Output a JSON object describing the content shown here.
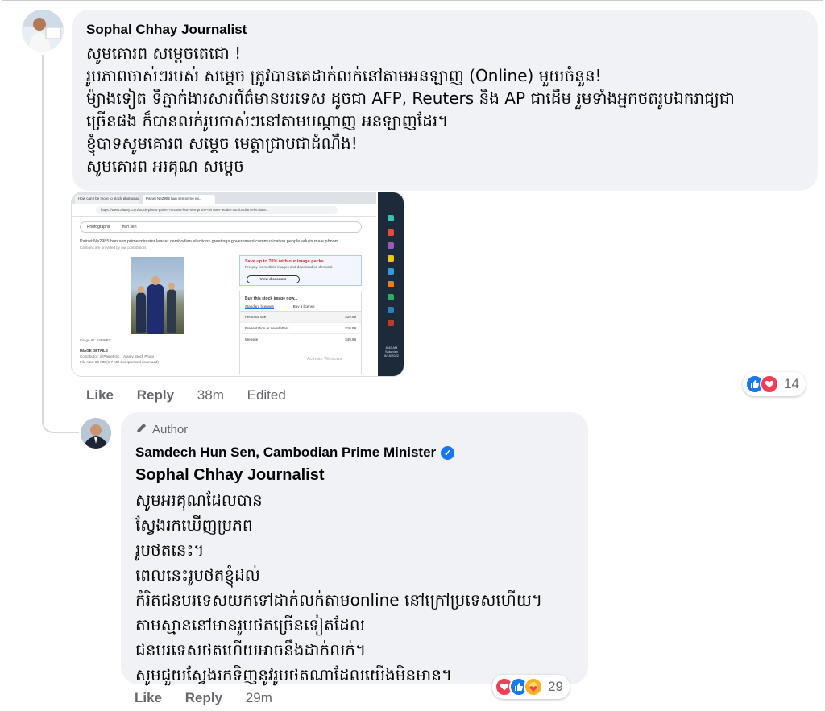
{
  "comment1": {
    "author": "Sophal Chhay Journalist",
    "lines": [
      "សូមគោរព សម្ដេចតេជោ !",
      "រូបភាពចាស់ៗរបស់ សម្ដេច ត្រូវបានគេដាក់លក់នៅតាមអនឡាញ (Online) មួយចំនួន!",
      "ម៉្យាងទៀត ទីភ្នាក់ងារសារព័ត៌មានបរទេស ដូចជា AFP, Reuters និង AP ជាដើម រួមទាំងអ្នកថតរូបឯករាជ្យជា",
      "ច្រើនផង ក៏បានលក់រូបចាស់ៗនៅតាមបណ្ដាញ អនឡាញដែរ។",
      "ខ្ញុំបាទសូមគោរព សម្ដេច មេត្តាជ្រាបជាដំណឹង!",
      "សូមគោរព អរគុណ សម្ដេច"
    ],
    "actions": {
      "like": "Like",
      "reply": "Reply",
      "time": "38m",
      "edited": "Edited"
    },
    "reactions": {
      "icons": [
        "like-icon",
        "love-icon"
      ],
      "count": "14"
    }
  },
  "attachment": {
    "tab1": "How can I be more to stock photograph...",
    "tab2": "Painet NeZ985 hun sen prime mi...",
    "url": "https://www.alamy.com/stock-photo-painet-ne2985-hun-sen-prime-minister-leader-cambodian-elections...",
    "search_scope": "Photographs",
    "search_query": "hun sen",
    "image_title": "Painet Ne2985 hun sen prime minister leader cambodian elections greetings government communication people adults male phnom",
    "caption": "Captions are provided by our contributors.",
    "promo_title": "Save up to 70% with our image packs",
    "promo_sub": "Pre-pay for multiple images and download on demand.",
    "promo_button": "View discounts",
    "buy_title": "Buy this stock image now...",
    "license_tabs": [
      "Standard licenses",
      "Buy a license"
    ],
    "options": [
      {
        "label": "Personal use",
        "price": "$19.99"
      },
      {
        "label": "Presentation or newsletters",
        "price": "$19.99"
      },
      {
        "label": "Website",
        "price": "$49.99"
      }
    ],
    "image_id": "Image ID: A5MKBY",
    "details_header": "IMAGE DETAILS",
    "contributor_label": "Contributor:",
    "contributor": "@Painet Inc. / Alamy Stock Photo",
    "filesize_label": "File size:",
    "filesize": "50 MB (1.7 MB Compressed download)",
    "watermark": "Activate Windows",
    "clock": "8:42 AM Saturday 6/18/2022"
  },
  "comment2": {
    "author_tag": "Author",
    "author": "Samdech Hun Sen, Cambodian Prime Minister",
    "mention": "Sophal Chhay Journalist",
    "lines": [
      "សូមអរគុណដែលបាន",
      "ស្វែងរកឃើញប្រភព",
      "រូបថតនេះ។",
      "ពេលនេះរូបថតខ្ញុំដល់",
      "កំរិតជនបរទេសយកទៅដាក់លក់តាមonline នៅក្រៅប្រទេសហើយ។",
      "តាមស្មាននៅមានរូបថតច្រើនទៀតដែល",
      "ជនបរទេសថតហើយអាចនឹងដាក់លក់។",
      "សូមជួយស្វែងរកទិញនូវរូបថតណាដែលយើងមិនមាន។"
    ],
    "actions": {
      "like": "Like",
      "reply": "Reply",
      "time": "29m"
    },
    "reactions": {
      "icons": [
        "love-icon",
        "like-icon",
        "care-icon"
      ],
      "count": "29"
    }
  },
  "colors": {
    "bubble": "#f0f2f5",
    "meta": "#65676b",
    "like": "#1877f2",
    "love": "#f33e58",
    "care": "#f7b125"
  }
}
